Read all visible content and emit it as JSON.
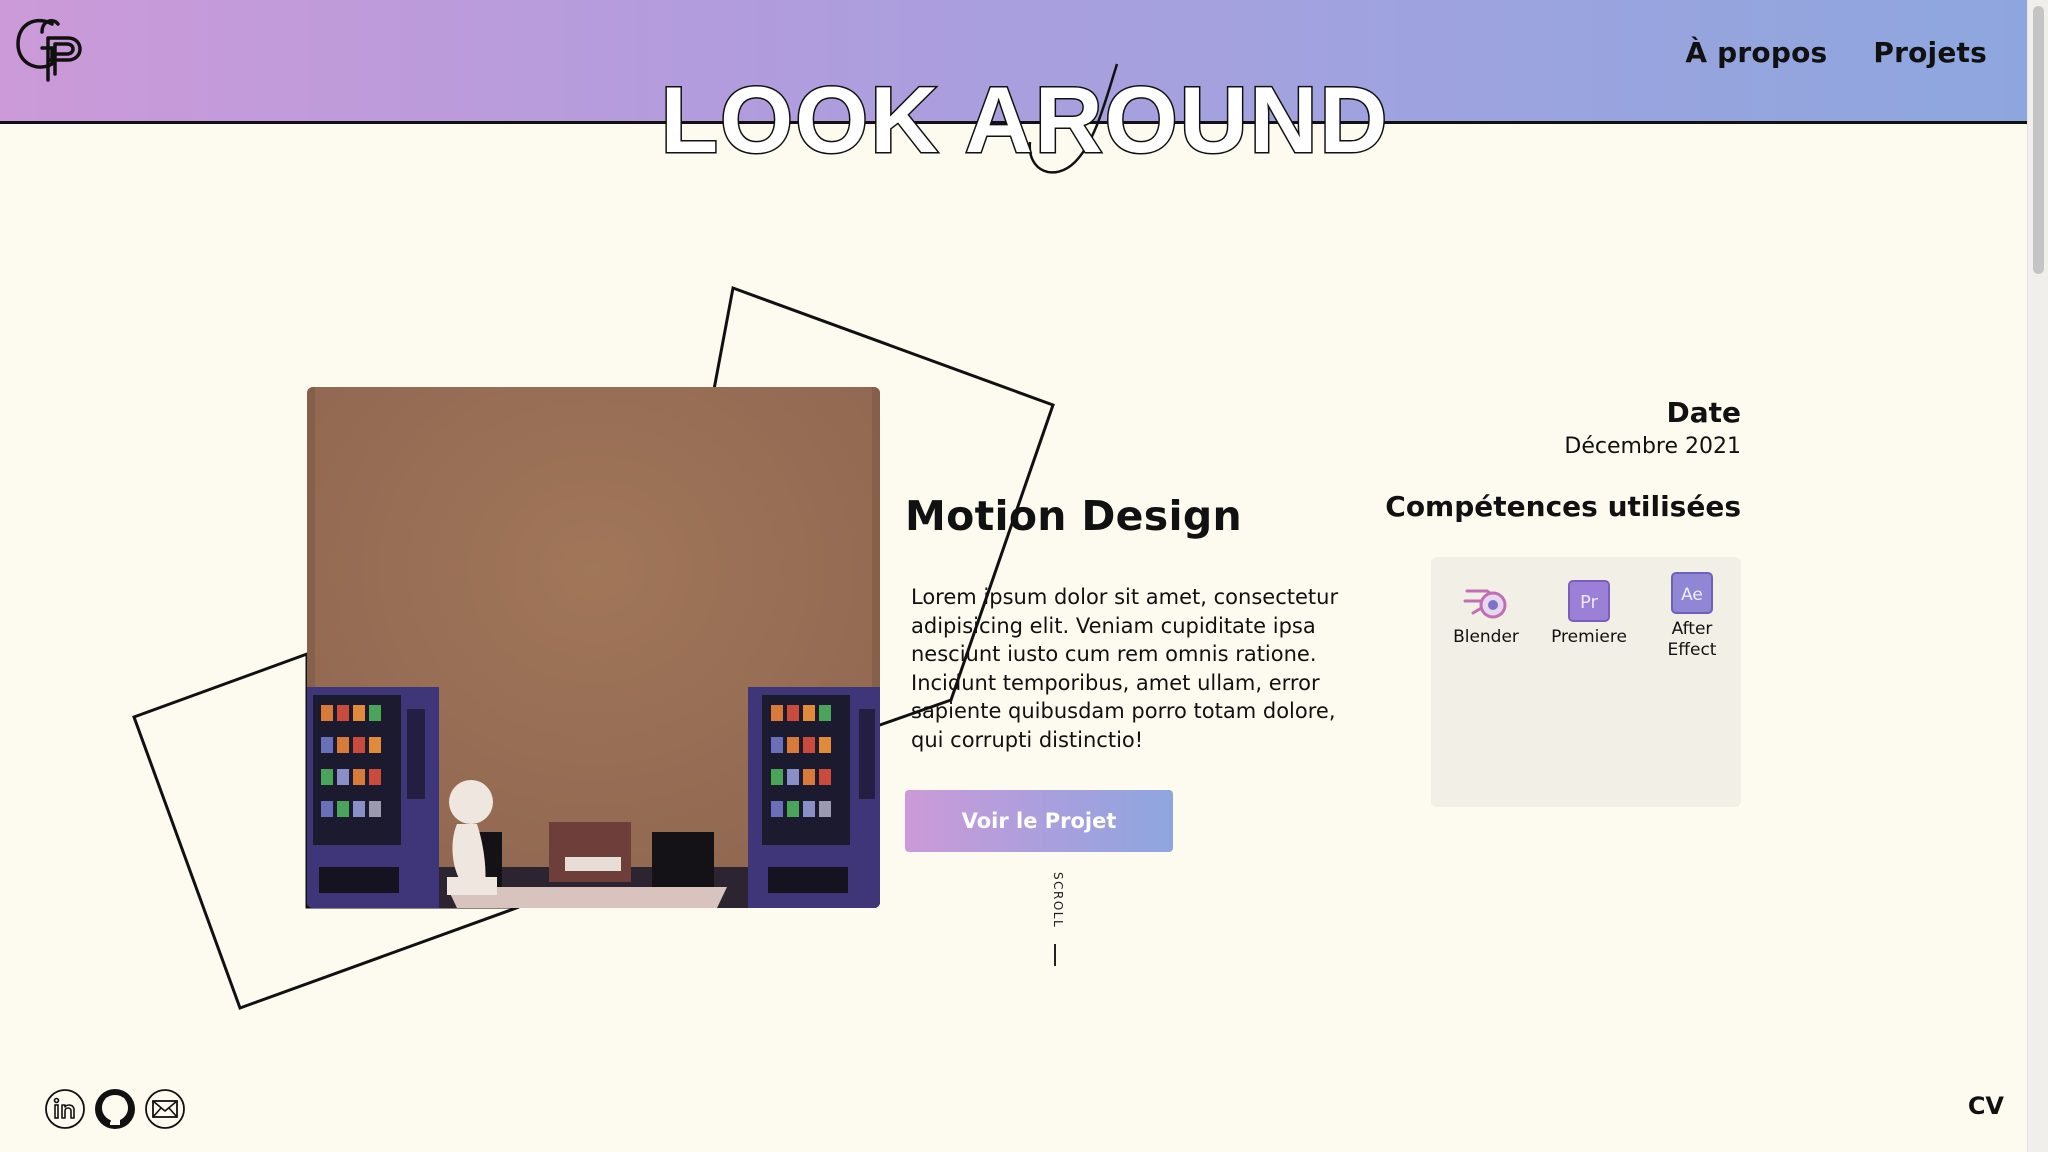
{
  "header": {
    "logo_text": "GP",
    "hero_title": "LOOK AROUND",
    "nav": [
      {
        "label": "À propos"
      },
      {
        "label": "Projets"
      }
    ]
  },
  "project": {
    "title": "Motion Design",
    "description": "Lorem ipsum dolor sit amet, consectetur adipisicing elit. Veniam cupiditate ipsa nesciunt iusto cum rem omnis ratione. Incidunt temporibus, amet ullam, error sapiente quibusdam porro totam dolore, qui corrupti distinctio!",
    "cta_label": "Voir le Projet",
    "scroll_label": "SCROLL"
  },
  "details": {
    "date_heading": "Date",
    "date_value": "Décembre 2021",
    "skills_heading": "Compétences utilisées",
    "skills": [
      {
        "label": "Blender",
        "icon": "blender-icon"
      },
      {
        "label": "Premiere",
        "icon": "premiere-icon",
        "abbr": "Pr"
      },
      {
        "label": "After Effect",
        "icon": "after-effects-icon",
        "abbr": "Ae"
      }
    ]
  },
  "footer": {
    "social": [
      {
        "icon": "linkedin-icon"
      },
      {
        "icon": "github-icon"
      },
      {
        "icon": "mail-icon"
      }
    ],
    "cv_label": "CV"
  },
  "colors": {
    "background": "#fdfbf0",
    "gradient_start": "#cc9ad8",
    "gradient_end": "#8ea6de",
    "accent_purple": "#8f6fc9",
    "text": "#111111"
  }
}
